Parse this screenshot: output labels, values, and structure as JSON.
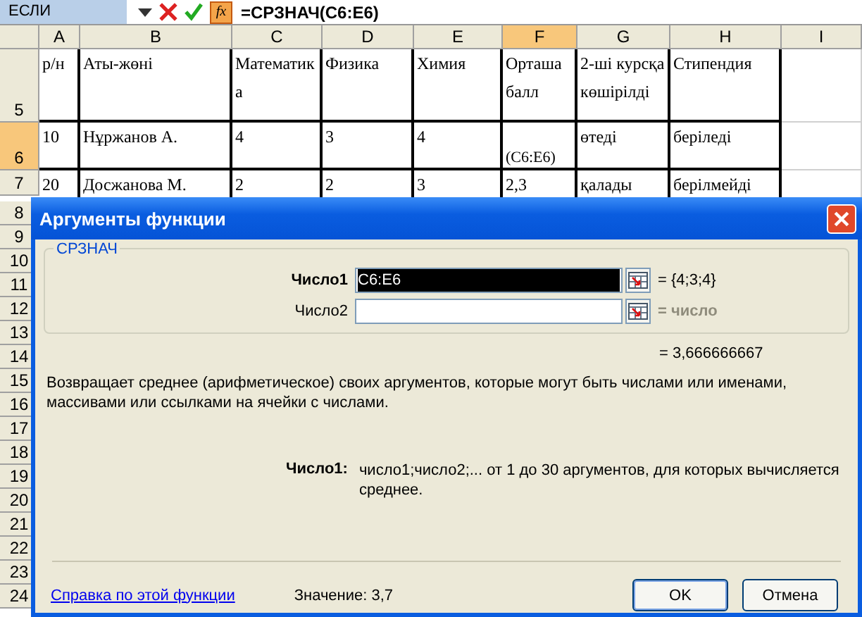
{
  "formula_bar": {
    "name_box": "ЕСЛИ",
    "fx_label": "fx",
    "formula": "=СРЗНАЧ(C6:E6)"
  },
  "columns": [
    {
      "label": "A",
      "selected": false
    },
    {
      "label": "B",
      "selected": false
    },
    {
      "label": "C",
      "selected": false
    },
    {
      "label": "D",
      "selected": false
    },
    {
      "label": "E",
      "selected": false
    },
    {
      "label": "F",
      "selected": true
    },
    {
      "label": "G",
      "selected": false
    },
    {
      "label": "H",
      "selected": false
    },
    {
      "label": "I",
      "selected": false
    }
  ],
  "rows": [
    {
      "number": "5",
      "selected": false,
      "cells": [
        {
          "text": "р/н"
        },
        {
          "text": "Аты-жөні"
        },
        {
          "text": "Математика"
        },
        {
          "text": "Физика"
        },
        {
          "text": "Химия"
        },
        {
          "text": "Орташа балл"
        },
        {
          "text": "2-ші курсқа көшірілді"
        },
        {
          "text": "Стипендия"
        },
        null
      ]
    },
    {
      "number": "6",
      "selected": true,
      "cells": [
        {
          "text": "10"
        },
        {
          "text": "Нұржанов А."
        },
        {
          "text": "4"
        },
        {
          "text": "3"
        },
        {
          "text": "4"
        },
        {
          "text": "(C6:E6)",
          "kind": "edit-tip"
        },
        {
          "text": "өтеді"
        },
        {
          "text": "беріледі"
        },
        null
      ]
    },
    {
      "number": "7",
      "selected": false,
      "cells": [
        {
          "text": "20"
        },
        {
          "text": "Досжанова М."
        },
        {
          "text": "2"
        },
        {
          "text": "2"
        },
        {
          "text": "3"
        },
        {
          "text": "2,3"
        },
        {
          "text": "қалады"
        },
        {
          "text": "берілмейді"
        },
        null
      ]
    },
    {
      "number": "8",
      "selected": false
    },
    {
      "number": "9",
      "selected": false
    },
    {
      "number": "10",
      "selected": false
    },
    {
      "number": "11",
      "selected": false
    },
    {
      "number": "12",
      "selected": false
    },
    {
      "number": "13",
      "selected": false
    },
    {
      "number": "14",
      "selected": false
    },
    {
      "number": "15",
      "selected": false
    },
    {
      "number": "16",
      "selected": false
    },
    {
      "number": "17",
      "selected": false
    },
    {
      "number": "18",
      "selected": false
    },
    {
      "number": "19",
      "selected": false
    },
    {
      "number": "20",
      "selected": false
    },
    {
      "number": "21",
      "selected": false
    },
    {
      "number": "22",
      "selected": false
    },
    {
      "number": "23",
      "selected": false
    },
    {
      "number": "24",
      "selected": false
    }
  ],
  "dialog": {
    "title": "Аргументы функции",
    "group": "СРЗНАЧ",
    "args": [
      {
        "label": "Число1",
        "value": "C6:E6",
        "active": true,
        "result": "= {4;3;4}",
        "result_dimmed": false
      },
      {
        "label": "Число2",
        "active": false,
        "result": "= число",
        "result_dimmed": true
      }
    ],
    "formula_result": "= 3,666666667",
    "description": "Возвращает среднее (арифметическое) своих аргументов, которые могут быть числами или именами, массивами или ссылками на ячейки с числами.",
    "arg_help": {
      "label": "Число1:",
      "text": "число1;число2;... от 1 до 30 аргументов, для которых вычисляется среднее."
    },
    "help_link": "Справка по этой функции",
    "value": "Значение: 3,7",
    "buttons": [
      {
        "label": "OK",
        "default": true
      },
      {
        "label": "Отмена",
        "default": false
      }
    ]
  }
}
